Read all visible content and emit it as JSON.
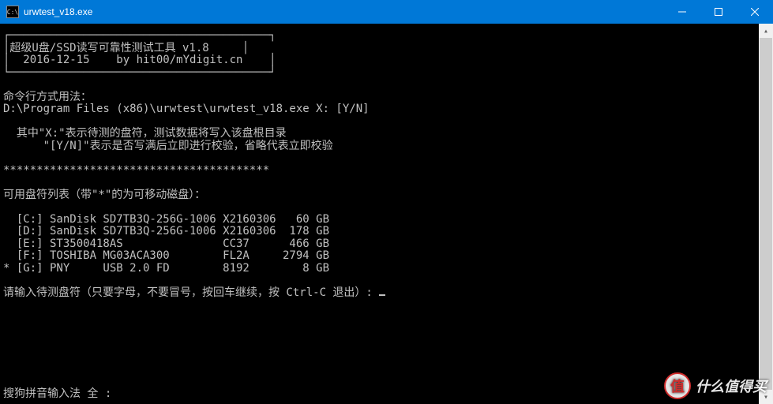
{
  "window": {
    "title": "urwtest_v18.exe",
    "icon_hint": "C:\\"
  },
  "banner": {
    "top": "┌───────────────────────────────────────┐",
    "line1": "│超级U盘/SSD读写可靠性测试工具 v1.8     │",
    "line2": "│  2016-12-15    by hit00/mYdigit.cn    │",
    "bot": "└───────────────────────────────────────┘"
  },
  "usage": {
    "header": "命令行方式用法：",
    "path": "D:\\Program Files (x86)\\urwtest\\urwtest_v18.exe X: [Y/N]",
    "note1": "  其中\"X:\"表示待测的盘符，测试数据将写入该盘根目录",
    "note2": "      \"[Y/N]\"表示是否写满后立即进行校验，省略代表立即校验"
  },
  "divider": "****************************************",
  "drives": {
    "header": "可用盘符列表（带\"*\"的为可移动磁盘）：",
    "items": [
      {
        "star": " ",
        "letter": "[C:]",
        "model": "SanDisk SD7TB3Q-256G-1006",
        "fw": "X2160306",
        "size": "60 GB"
      },
      {
        "star": " ",
        "letter": "[D:]",
        "model": "SanDisk SD7TB3Q-256G-1006",
        "fw": "X2160306",
        "size": "178 GB"
      },
      {
        "star": " ",
        "letter": "[E:]",
        "model": "ST3500418AS",
        "fw": "CC37",
        "size": "466 GB"
      },
      {
        "star": " ",
        "letter": "[F:]",
        "model": "TOSHIBA MG03ACA300",
        "fw": "FL2A",
        "size": "2794 GB"
      },
      {
        "star": "*",
        "letter": "[G:]",
        "model": "PNY     USB 2.0 FD",
        "fw": "8192",
        "size": "8 GB"
      }
    ]
  },
  "prompt": "请输入待测盘符（只要字母，不要冒号，按回车继续，按 Ctrl-C 退出）: ",
  "ime": "搜狗拼音输入法 全 :",
  "watermark": {
    "badge": "值",
    "text": "什么值得买"
  }
}
